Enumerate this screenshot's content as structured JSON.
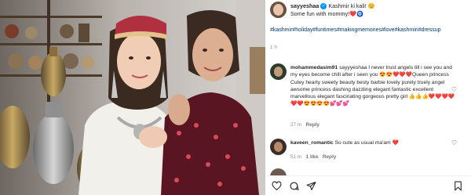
{
  "post": {
    "username": "sayyeshaa",
    "caption": "Kashmir ki kali! 😊",
    "caption_line2": "Some fun with mommy!",
    "caption_line2_emoji": "❤️🧿",
    "hashtags": "#kashmir#holiday#funtimes#makingmemories#love#kashmiri#dressup",
    "time": "1 h"
  },
  "comments": [
    {
      "username": "mohammedasim91",
      "text": "sayyyeshaa I never trust angels till i see you and my eyes become chill after i seen you 😍😍❤️❤️❤️Queen princess Cutey hearty sweety beauty besty barbie lovely purely truely angel awsome princess dashing dazzling elegant fantastic excellent marvellous elegant fascinating gorgeous pretty girl 👍👍👍❤️❤️❤️❤️❤️❤️😍😍😍😍💕💕💕",
      "time": "27 m",
      "reply": "Reply"
    },
    {
      "username": "kaveen_romantic",
      "text": "So cute as usual ma'am ❤️",
      "time": "51 m",
      "likes": "1 like",
      "reply": "Reply"
    }
  ],
  "icons": [
    "avatar",
    "verified-icon",
    "heart-icon",
    "comment-icon",
    "share-icon",
    "bookmark-icon"
  ],
  "colors": {
    "verified": "#0095f6",
    "hashtag": "#00376b",
    "meta": "#8e8e8e"
  }
}
